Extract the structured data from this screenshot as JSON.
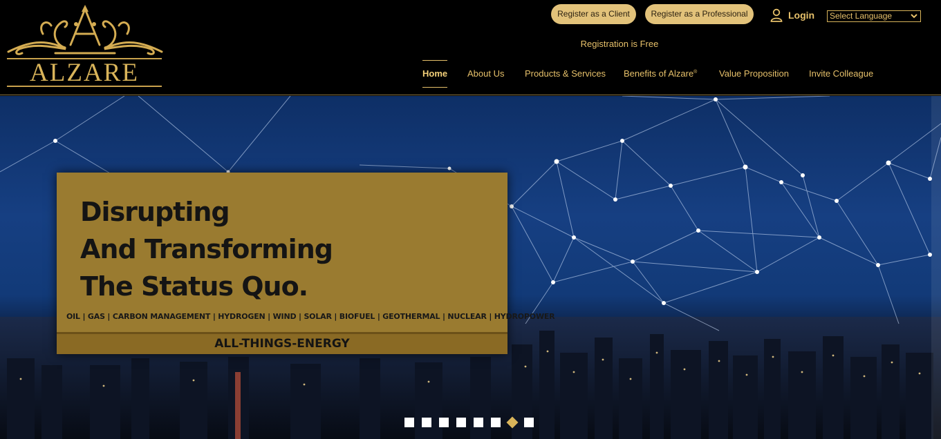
{
  "brand": {
    "name": "ALZARE",
    "logo_letter": "A",
    "logo_icon": "alzare-crest-logo"
  },
  "header": {
    "register_client": "Register as a Client",
    "register_professional": "Register as a Professional",
    "login_label": "Login",
    "login_icon": "user-icon",
    "language_select": {
      "selected": "Select Language",
      "icon": "chevron-down-icon"
    },
    "registration_note": "Registration is Free"
  },
  "nav": {
    "items": [
      {
        "label": "Home",
        "active": true
      },
      {
        "label": "About Us",
        "active": false
      },
      {
        "label": "Products & Services",
        "active": false
      },
      {
        "label": "Benefits of Alzare",
        "sup": "®",
        "active": false
      },
      {
        "label": "Value Proposition",
        "active": false
      },
      {
        "label": "Invite Colleague",
        "active": false
      }
    ]
  },
  "hero": {
    "headline": [
      "Disrupting",
      "And Transforming",
      "The Status Quo."
    ],
    "tags": "OIL | GAS | CARBON MANAGEMENT | HYDROGEN | WIND | SOLAR | BIOFUEL | GEOTHERMAL | NUCLEAR | HYDROPOWER",
    "strip": "ALL-THINGS-ENERGY",
    "slides_total": 8,
    "active_slide": 7
  },
  "colors": {
    "gold": "#e6c06a",
    "banner": "#9a7b30",
    "button": "#e2c27a",
    "background": "#000000"
  }
}
